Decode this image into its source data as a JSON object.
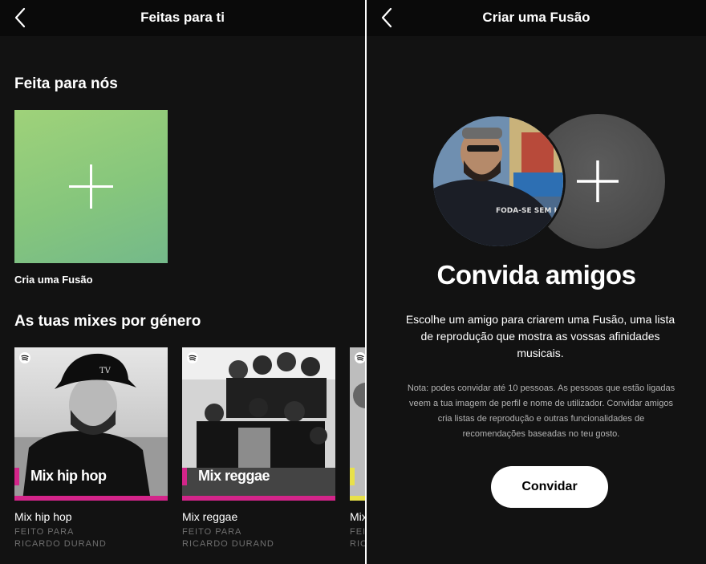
{
  "left_screen": {
    "header": {
      "title": "Feitas para ti"
    },
    "section_made_for_us": {
      "title": "Feita para nós",
      "tile_label": "Cria uma Fusão"
    },
    "section_genre_mixes": {
      "title": "As tuas mixes por género",
      "mixes": [
        {
          "cover_label": "Mix hip hop",
          "name": "Mix hip hop",
          "sub_line1": "FEITO PARA",
          "sub_line2": "RICARDO DURAND",
          "accent": "#d3258a"
        },
        {
          "cover_label": "Mix reggae",
          "name": "Mix reggae",
          "sub_line1": "FEITO PARA",
          "sub_line2": "RICARDO DURAND",
          "accent": "#d3258a"
        },
        {
          "cover_label": "",
          "name": "Mix",
          "sub_line1": "FEI",
          "sub_line2": "RIC",
          "accent": "#e8e14a"
        }
      ]
    }
  },
  "right_screen": {
    "header": {
      "title": "Criar uma Fusão"
    },
    "heading": "Convida amigos",
    "description": "Escolhe um amigo para criarem uma Fusão, uma lista de reprodução que mostra as vossas afinidades musicais.",
    "note": "Nota: podes convidar até 10 pessoas. As pessoas que estão ligadas veem a tua imagem de perfil e nome de utilizador. Convidar amigos cria listas de reprodução e outras funcionalidades de recomendações baseadas no teu gosto.",
    "invite_button": "Convidar",
    "avatar_shirt_text": "FODA-SE SEM HETERO"
  },
  "icons": {
    "back": "chevron-left-icon",
    "plus": "plus-icon",
    "spotify": "spotify-logo-icon"
  },
  "colors": {
    "background": "#121212",
    "header": "#0a0a0a",
    "fusion_tile": "#8bc97c",
    "mix_accent_pink": "#d3258a",
    "mix_accent_yellow": "#e8e14a",
    "invite_circle": "#4f4f4f",
    "button": "#ffffff"
  }
}
